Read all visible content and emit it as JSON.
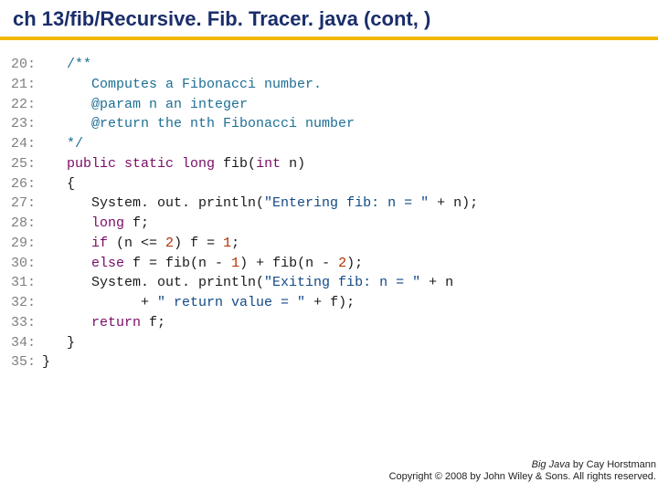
{
  "title": "ch 13/fib/Recursive. Fib. Tracer. java  (cont, )",
  "footer": {
    "book": "Big Java",
    "by": " by Cay Horstmann",
    "copyright": "Copyright © 2008 by John Wiley & Sons. All rights reserved."
  },
  "chart_data": {
    "type": "table",
    "title": "Java source listing lines 20–35",
    "columns": [
      "line_number",
      "source"
    ],
    "rows": [
      [
        20,
        "   /**"
      ],
      [
        21,
        "      Computes a Fibonacci number."
      ],
      [
        22,
        "      @param n an integer"
      ],
      [
        23,
        "      @return the nth Fibonacci number"
      ],
      [
        24,
        "   */"
      ],
      [
        25,
        "   public static long fib(int n)"
      ],
      [
        26,
        "   {"
      ],
      [
        27,
        "      System. out. println(\"Entering fib: n = \" + n);"
      ],
      [
        28,
        "      long f;"
      ],
      [
        29,
        "      if (n <= 2) f = 1;"
      ],
      [
        30,
        "      else f = fib(n - 1) + fib(n - 2);"
      ],
      [
        31,
        "      System. out. println(\"Exiting fib: n = \" + n"
      ],
      [
        32,
        "            + \" return value = \" + f);"
      ],
      [
        33,
        "      return f;"
      ],
      [
        34,
        "   }"
      ],
      [
        35,
        "}"
      ]
    ]
  },
  "code_lines": [
    {
      "n": 20,
      "tokens": [
        {
          "c": "pl",
          "t": "   "
        },
        {
          "c": "cm",
          "t": "/**"
        }
      ]
    },
    {
      "n": 21,
      "tokens": [
        {
          "c": "pl",
          "t": "      "
        },
        {
          "c": "cm",
          "t": "Computes a Fibonacci number."
        }
      ]
    },
    {
      "n": 22,
      "tokens": [
        {
          "c": "pl",
          "t": "      "
        },
        {
          "c": "cm",
          "t": "@param n an integer"
        }
      ]
    },
    {
      "n": 23,
      "tokens": [
        {
          "c": "pl",
          "t": "      "
        },
        {
          "c": "cm",
          "t": "@return the nth Fibonacci number"
        }
      ]
    },
    {
      "n": 24,
      "tokens": [
        {
          "c": "pl",
          "t": "   "
        },
        {
          "c": "cm",
          "t": "*/"
        }
      ]
    },
    {
      "n": 25,
      "tokens": [
        {
          "c": "pl",
          "t": "   "
        },
        {
          "c": "kw",
          "t": "public static long"
        },
        {
          "c": "pl",
          "t": " fib("
        },
        {
          "c": "kw",
          "t": "int"
        },
        {
          "c": "pl",
          "t": " n)"
        }
      ]
    },
    {
      "n": 26,
      "tokens": [
        {
          "c": "pl",
          "t": "   {"
        }
      ]
    },
    {
      "n": 27,
      "tokens": [
        {
          "c": "pl",
          "t": "      System. out. println("
        },
        {
          "c": "st",
          "t": "\"Entering fib: n = \""
        },
        {
          "c": "pl",
          "t": " + n);"
        }
      ]
    },
    {
      "n": 28,
      "tokens": [
        {
          "c": "pl",
          "t": "      "
        },
        {
          "c": "kw",
          "t": "long"
        },
        {
          "c": "pl",
          "t": " f;"
        }
      ]
    },
    {
      "n": 29,
      "tokens": [
        {
          "c": "pl",
          "t": "      "
        },
        {
          "c": "kw",
          "t": "if"
        },
        {
          "c": "pl",
          "t": " (n <= "
        },
        {
          "c": "nm",
          "t": "2"
        },
        {
          "c": "pl",
          "t": ") f = "
        },
        {
          "c": "nm",
          "t": "1"
        },
        {
          "c": "pl",
          "t": ";"
        }
      ]
    },
    {
      "n": 30,
      "tokens": [
        {
          "c": "pl",
          "t": "      "
        },
        {
          "c": "kw",
          "t": "else"
        },
        {
          "c": "pl",
          "t": " f = fib(n - "
        },
        {
          "c": "nm",
          "t": "1"
        },
        {
          "c": "pl",
          "t": ") + fib(n - "
        },
        {
          "c": "nm",
          "t": "2"
        },
        {
          "c": "pl",
          "t": ");"
        }
      ]
    },
    {
      "n": 31,
      "tokens": [
        {
          "c": "pl",
          "t": "      System. out. println("
        },
        {
          "c": "st",
          "t": "\"Exiting fib: n = \""
        },
        {
          "c": "pl",
          "t": " + n"
        }
      ]
    },
    {
      "n": 32,
      "tokens": [
        {
          "c": "pl",
          "t": "            + "
        },
        {
          "c": "st",
          "t": "\" return value = \""
        },
        {
          "c": "pl",
          "t": " + f);"
        }
      ]
    },
    {
      "n": 33,
      "tokens": [
        {
          "c": "pl",
          "t": "      "
        },
        {
          "c": "kw",
          "t": "return"
        },
        {
          "c": "pl",
          "t": " f;"
        }
      ]
    },
    {
      "n": 34,
      "tokens": [
        {
          "c": "pl",
          "t": "   }"
        }
      ]
    },
    {
      "n": 35,
      "tokens": [
        {
          "c": "pl",
          "t": "}"
        }
      ]
    }
  ]
}
